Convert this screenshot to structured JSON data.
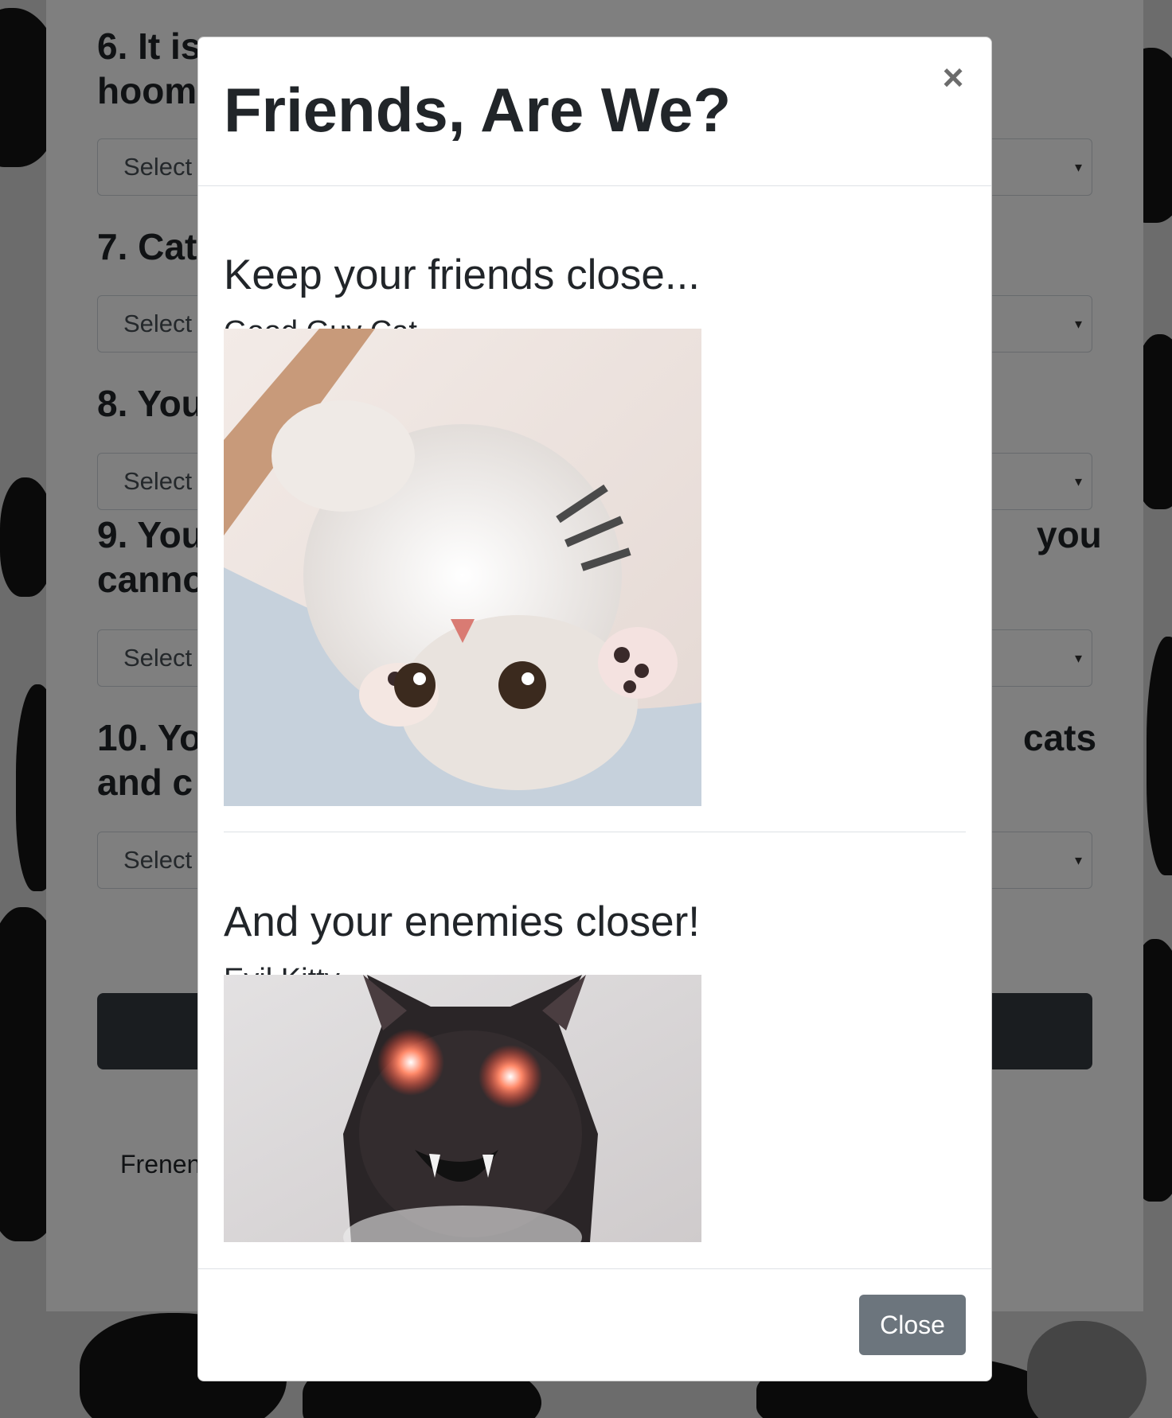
{
  "background_page": {
    "questions": [
      {
        "number_label": "6. It is",
        "line2": "hoom"
      },
      {
        "number_label": "7. Cat"
      },
      {
        "number_label": "8. You"
      },
      {
        "number_label": "9. You",
        "line2": "canno",
        "tail": "you"
      },
      {
        "number_label": "10. Yo",
        "line2": "and c",
        "tail": "cats"
      }
    ],
    "select_placeholder": "Select",
    "footer_text": "Frenen"
  },
  "modal": {
    "title": "Friends, Are We?",
    "close_symbol": "×",
    "section1": {
      "heading": "Keep your friends close...",
      "caption": "Good Guy Cat"
    },
    "section2": {
      "heading": "And your enemies closer!",
      "caption": "Evil Kitty"
    },
    "close_button_label": "Close"
  },
  "colors": {
    "close_button": "#6c757d",
    "submit_button": "#343a40",
    "text": "#212529"
  }
}
